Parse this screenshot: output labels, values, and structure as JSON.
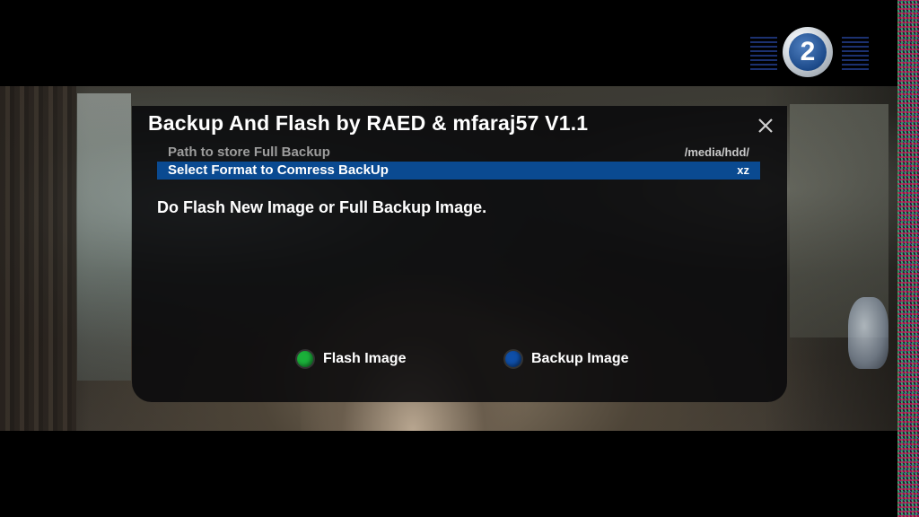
{
  "dialog": {
    "title": "Backup And Flash by RAED & mfaraj57   V1.1",
    "rows": [
      {
        "label": "Path to store Full Backup",
        "value": "/media/hdd/",
        "selected": false
      },
      {
        "label": "Select Format to Comress BackUp",
        "value": "xz",
        "selected": true
      }
    ],
    "message": "Do Flash New Image or Full Backup Image.",
    "buttons": {
      "flash": {
        "label": "Flash Image",
        "color": "#1bb03a"
      },
      "backup": {
        "label": "Backup Image",
        "color": "#0f4fa8"
      }
    },
    "close_icon": "close-icon"
  },
  "channel_logo": {
    "text": "2"
  },
  "colors": {
    "selection_bar": "#0a4a91",
    "dialog_bg": "#08080a",
    "unselected_text": "#9d9d9d"
  }
}
